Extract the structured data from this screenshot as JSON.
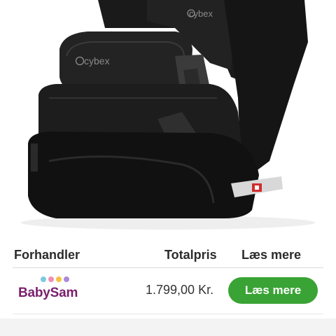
{
  "product_image": {
    "alt": "",
    "brand_marks": [
      "cybex",
      "cybex"
    ]
  },
  "table": {
    "headers": {
      "dealer": "Forhandler",
      "total": "Totalpris",
      "more": "Læs mere"
    },
    "rows": [
      {
        "dealer": "BabySam",
        "dealer_dot_colors": [
          "#7ec8e3",
          "#f28fb3",
          "#f6c244",
          "#a98ad8"
        ],
        "price": "1.799,00 Kr.",
        "button_label": "Læs mere"
      }
    ]
  },
  "colors": {
    "button": "#3aa335",
    "dealer_brand": "#7a1f6d",
    "seat": "#1c1c1c"
  }
}
